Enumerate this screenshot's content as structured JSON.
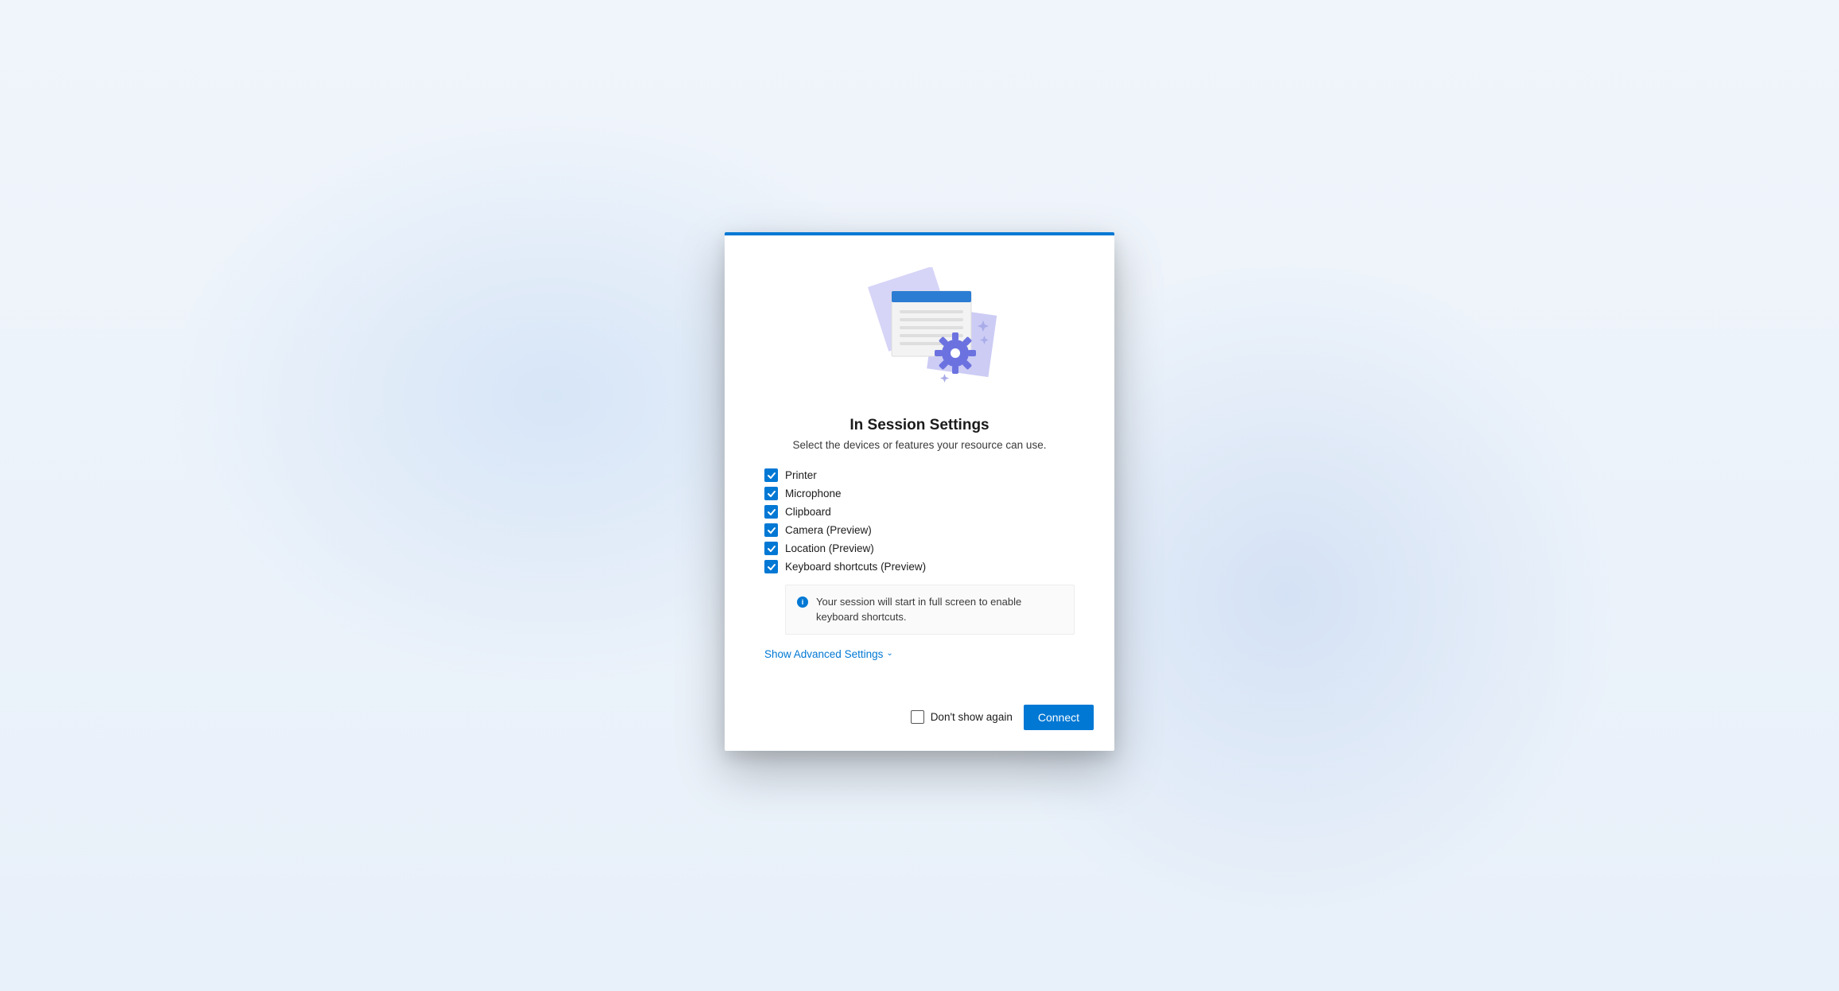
{
  "dialog": {
    "title": "In Session Settings",
    "subtitle": "Select the devices or features your resource can use.",
    "options": [
      {
        "label": "Printer",
        "checked": true
      },
      {
        "label": "Microphone",
        "checked": true
      },
      {
        "label": "Clipboard",
        "checked": true
      },
      {
        "label": "Camera (Preview)",
        "checked": true
      },
      {
        "label": "Location (Preview)",
        "checked": true
      },
      {
        "label": "Keyboard shortcuts (Preview)",
        "checked": true
      }
    ],
    "info_message": "Your session will start in full screen to enable keyboard shortcuts.",
    "advanced_link": "Show Advanced Settings",
    "dont_show_label": "Don't show again",
    "dont_show_checked": false,
    "connect_label": "Connect"
  }
}
